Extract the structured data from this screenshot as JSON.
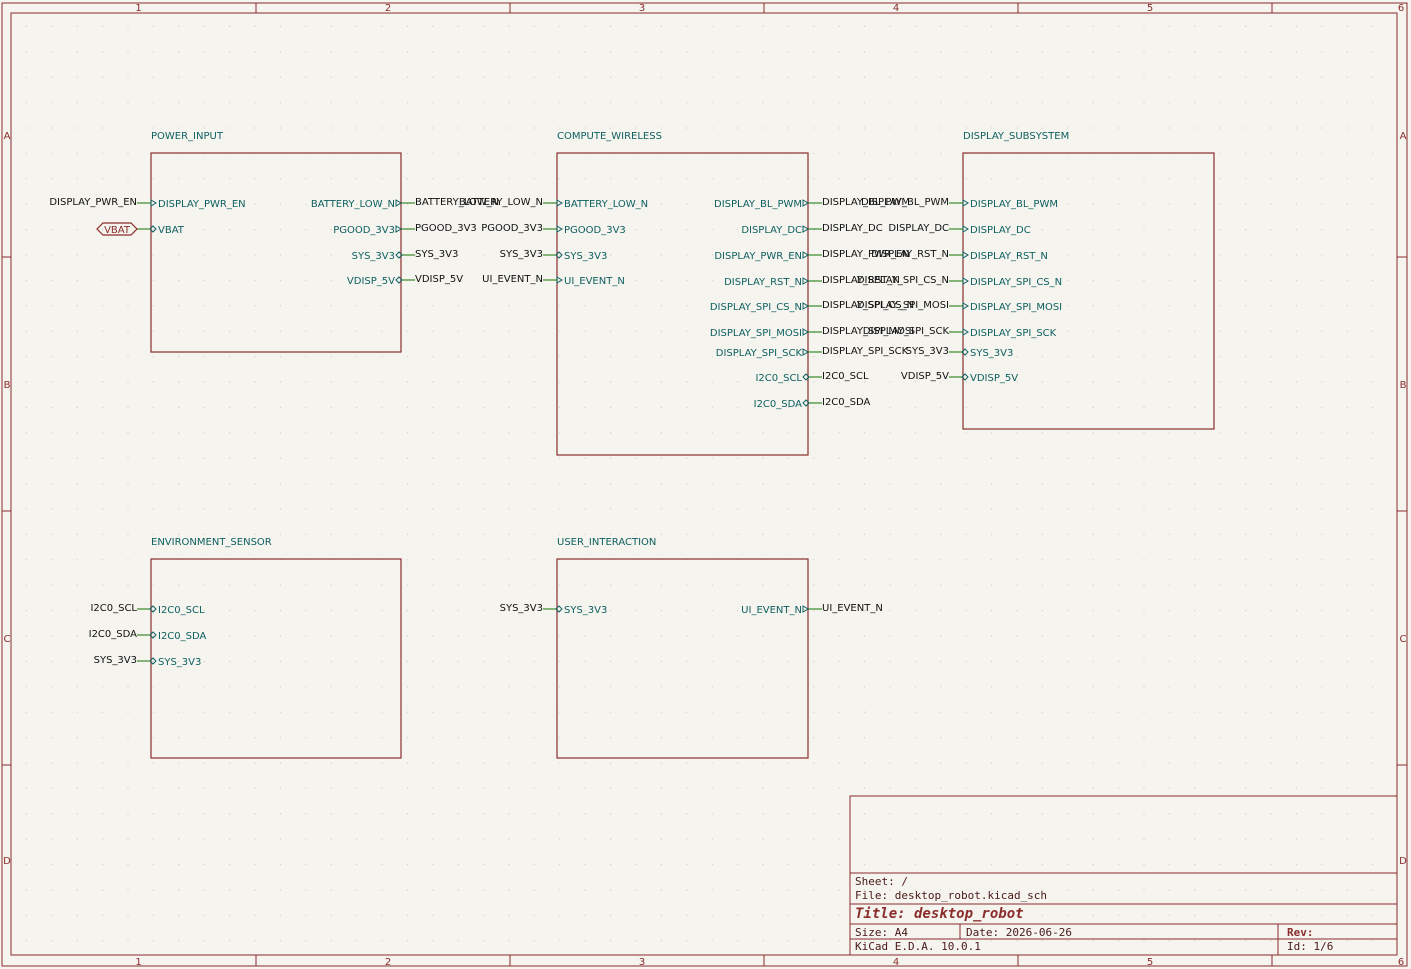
{
  "app": "KiCad schematic editor",
  "frame": {
    "columns": [
      "1",
      "2",
      "3",
      "4",
      "5",
      "6"
    ],
    "rows": [
      "A",
      "B",
      "C",
      "D"
    ]
  },
  "sheets": [
    {
      "id": "power_input",
      "title": "POWER_INPUT",
      "pins_left": [
        {
          "name": "DISPLAY_PWR_EN",
          "net": "DISPLAY_PWR_EN",
          "dir": "input"
        },
        {
          "name": "VBAT",
          "net": "VBAT",
          "dir": "bidir",
          "global": true
        }
      ],
      "pins_right": [
        {
          "name": "BATTERY_LOW_N",
          "net": "BATTERY_LOW_N",
          "dir": "input"
        },
        {
          "name": "PGOOD_3V3",
          "net": "PGOOD_3V3",
          "dir": "input"
        },
        {
          "name": "SYS_3V3",
          "net": "SYS_3V3",
          "dir": "bidir"
        },
        {
          "name": "VDISP_5V",
          "net": "VDISP_5V",
          "dir": "bidir"
        }
      ]
    },
    {
      "id": "compute_wireless",
      "title": "COMPUTE_WIRELESS",
      "pins_left": [
        {
          "name": "BATTERY_LOW_N",
          "net": "BATTERY_LOW_N",
          "dir": "input"
        },
        {
          "name": "PGOOD_3V3",
          "net": "PGOOD_3V3",
          "dir": "input"
        },
        {
          "name": "SYS_3V3",
          "net": "SYS_3V3",
          "dir": "bidir"
        },
        {
          "name": "UI_EVENT_N",
          "net": "UI_EVENT_N",
          "dir": "input"
        }
      ],
      "pins_right": [
        {
          "name": "DISPLAY_BL_PWM",
          "net": "DISPLAY_BL_PWM",
          "dir": "input"
        },
        {
          "name": "DISPLAY_DC",
          "net": "DISPLAY_DC",
          "dir": "input"
        },
        {
          "name": "DISPLAY_PWR_EN",
          "net": "DISPLAY_PWR_EN",
          "dir": "input"
        },
        {
          "name": "DISPLAY_RST_N",
          "net": "DISPLAY_RST_N",
          "dir": "input"
        },
        {
          "name": "DISPLAY_SPI_CS_N",
          "net": "DISPLAY_SPI_CS_N",
          "dir": "input"
        },
        {
          "name": "DISPLAY_SPI_MOSI",
          "net": "DISPLAY_SPI_MOSI",
          "dir": "input"
        },
        {
          "name": "DISPLAY_SPI_SCK",
          "net": "DISPLAY_SPI_SCK",
          "dir": "input"
        },
        {
          "name": "I2C0_SCL",
          "net": "I2C0_SCL",
          "dir": "bidir"
        },
        {
          "name": "I2C0_SDA",
          "net": "I2C0_SDA",
          "dir": "bidir"
        }
      ]
    },
    {
      "id": "display_subsystem",
      "title": "DISPLAY_SUBSYSTEM",
      "pins_left": [
        {
          "name": "DISPLAY_BL_PWM",
          "net": "DISPLAY_BL_PWM",
          "dir": "input"
        },
        {
          "name": "DISPLAY_DC",
          "net": "DISPLAY_DC",
          "dir": "input"
        },
        {
          "name": "DISPLAY_RST_N",
          "net": "DISPLAY_RST_N",
          "dir": "input"
        },
        {
          "name": "DISPLAY_SPI_CS_N",
          "net": "DISPLAY_SPI_CS_N",
          "dir": "input"
        },
        {
          "name": "DISPLAY_SPI_MOSI",
          "net": "DISPLAY_SPI_MOSI",
          "dir": "input"
        },
        {
          "name": "DISPLAY_SPI_SCK",
          "net": "DISPLAY_SPI_SCK",
          "dir": "input"
        },
        {
          "name": "SYS_3V3",
          "net": "SYS_3V3",
          "dir": "bidir"
        },
        {
          "name": "VDISP_5V",
          "net": "VDISP_5V",
          "dir": "bidir"
        }
      ],
      "pins_right": []
    },
    {
      "id": "environment_sensor",
      "title": "ENVIRONMENT_SENSOR",
      "pins_left": [
        {
          "name": "I2C0_SCL",
          "net": "I2C0_SCL",
          "dir": "bidir"
        },
        {
          "name": "I2C0_SDA",
          "net": "I2C0_SDA",
          "dir": "bidir"
        },
        {
          "name": "SYS_3V3",
          "net": "SYS_3V3",
          "dir": "bidir"
        }
      ],
      "pins_right": []
    },
    {
      "id": "user_interaction",
      "title": "USER_INTERACTION",
      "pins_left": [
        {
          "name": "SYS_3V3",
          "net": "SYS_3V3",
          "dir": "bidir"
        }
      ],
      "pins_right": [
        {
          "name": "UI_EVENT_N",
          "net": "UI_EVENT_N",
          "dir": "input"
        }
      ]
    }
  ],
  "title_block": {
    "sheet": "Sheet: /",
    "file": "File: desktop_robot.kicad_sch",
    "title": "Title: desktop_robot",
    "size": "Size: A4",
    "date": "Date: 2026-06-26",
    "rev": "Rev:",
    "tool": "KiCad E.D.A. 10.0.1",
    "id": "Id: 1/6"
  }
}
